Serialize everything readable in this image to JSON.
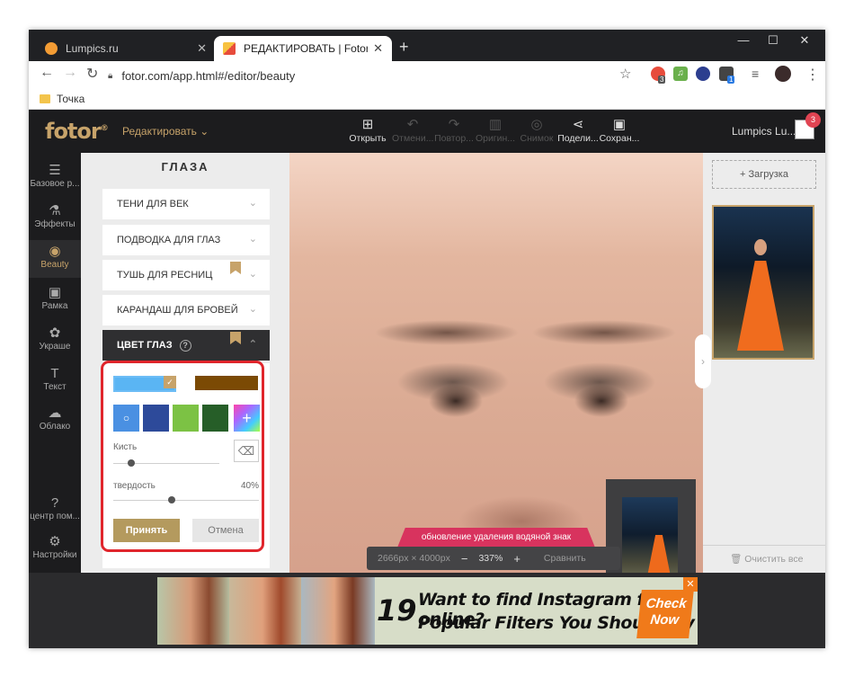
{
  "browser": {
    "tabs": [
      {
        "title": "Lumpics.ru",
        "close": "✕"
      },
      {
        "title": "РЕДАКТИРОВАТЬ | Fotor",
        "close": "✕"
      }
    ],
    "new_tab": "+",
    "window_controls": {
      "minimize": "—",
      "maximize": "☐",
      "close": "✕"
    },
    "nav": {
      "back": "←",
      "forward": "→",
      "reload": "↻"
    },
    "url": "fotor.com/app.html#/editor/beauty",
    "bookmark_star": "☆",
    "extension_badges": {
      "first": "3",
      "fourth": "1"
    },
    "menu_icon": "⋮",
    "bookmarks": [
      {
        "label": "Точка"
      }
    ]
  },
  "app": {
    "logo": "fotor",
    "logo_mark": "®",
    "edit_menu": "Редактировать",
    "tools": [
      {
        "label": "Открыть",
        "icon": "image-add-icon",
        "glyph": "⊞",
        "enabled": true
      },
      {
        "label": "Отмени...",
        "icon": "undo-icon",
        "glyph": "↶",
        "enabled": false
      },
      {
        "label": "Повтор...",
        "icon": "redo-icon",
        "glyph": "↷",
        "enabled": false
      },
      {
        "label": "Оригин...",
        "icon": "original-icon",
        "glyph": "▥",
        "enabled": false
      },
      {
        "label": "Снимок",
        "icon": "snapshot-icon",
        "glyph": "◎",
        "enabled": false
      },
      {
        "label": "Подели...",
        "icon": "share-icon",
        "glyph": "⋖",
        "enabled": true
      },
      {
        "label": "Сохран...",
        "icon": "save-icon",
        "glyph": "▣",
        "enabled": true
      }
    ],
    "user": {
      "name": "Lumpics Lu...",
      "badge": "3"
    },
    "sidebar": [
      {
        "label": "Базовое р...",
        "icon": "sliders-icon",
        "glyph": "☰"
      },
      {
        "label": "Эффекты",
        "icon": "flask-icon",
        "glyph": "⚗"
      },
      {
        "label": "Beauty",
        "icon": "eye-icon",
        "glyph": "◉",
        "active": true
      },
      {
        "label": "Рамка",
        "icon": "frame-icon",
        "glyph": "▣"
      },
      {
        "label": "Украше",
        "icon": "sticker-icon",
        "glyph": "✿"
      },
      {
        "label": "Текст",
        "icon": "text-icon",
        "glyph": "T"
      },
      {
        "label": "Облако",
        "icon": "cloud-icon",
        "glyph": "☁"
      },
      {
        "label": "центр пом...",
        "icon": "help-icon",
        "glyph": "?"
      },
      {
        "label": "Настройки",
        "icon": "settings-icon",
        "glyph": "⚙"
      }
    ]
  },
  "panel": {
    "title": "ГЛАЗА",
    "items": [
      {
        "label": "ТЕНИ ДЛЯ ВЕК",
        "premium": false
      },
      {
        "label": "ПОДВОДКА ДЛЯ ГЛАЗ",
        "premium": false
      },
      {
        "label": "ТУШЬ ДЛЯ РЕСНИЦ",
        "premium": true
      },
      {
        "label": "КАРАНДАШ ДЛЯ БРОВЕЙ",
        "premium": false
      },
      {
        "label": "ЦВЕТ ГЛАЗ",
        "premium": true,
        "active": true
      }
    ],
    "help_icon": "?",
    "eye_color": {
      "colors": [
        "#5ab5f3",
        "#7b4a04"
      ],
      "palette": [
        "#4a90e2",
        "#2d4a9a",
        "#7cc244",
        "#265e28"
      ],
      "palette_marker": "○",
      "custom_color": "+",
      "brush_label": "Кисть",
      "brush_value": 0.17,
      "hardness_label": "твердость",
      "hardness_value": "40%",
      "hardness_level": 0.4,
      "accept": "Принять",
      "cancel": "Отмена",
      "eraser_icon": "⌫"
    }
  },
  "canvas": {
    "watermark_notice": "обновление удаления водяной знак",
    "dimensions": "2666px × 4000px",
    "zoom_out": "−",
    "zoom": "337%",
    "zoom_in": "+",
    "compare": "Сравнить",
    "expand_icon": "↘"
  },
  "right_panel": {
    "upload": "+ Загрузка",
    "clear_all": "Очистить все",
    "collapse": "›"
  },
  "ad": {
    "number": "19",
    "line1": "Want to find Instagram filters online?",
    "line2": "Popular Filters You Should Try",
    "cta": "Check Now",
    "close": "✕"
  },
  "colors": {
    "accent": "#c7a36a",
    "highlight": "#e0252c",
    "watermark": "#d8335e"
  }
}
